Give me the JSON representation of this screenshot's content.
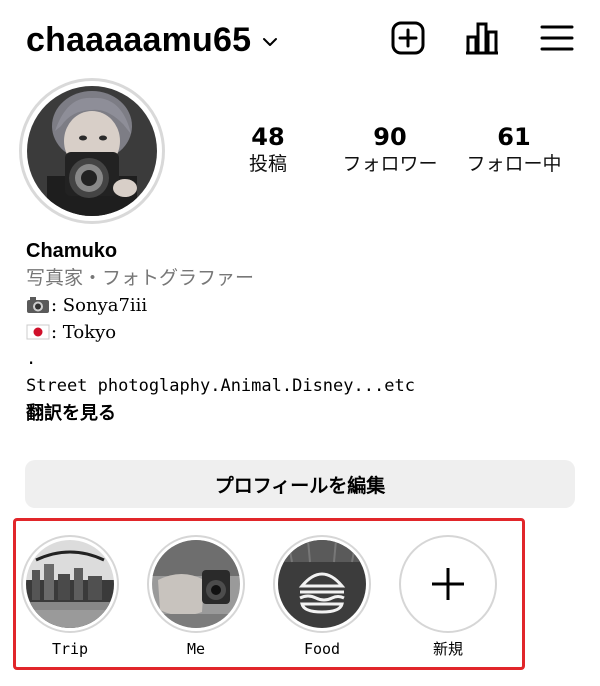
{
  "header": {
    "username": "chaaaaamu65"
  },
  "stats": [
    {
      "count": "48",
      "label": "投稿"
    },
    {
      "count": "90",
      "label": "フォロワー"
    },
    {
      "count": "61",
      "label": "フォロー中"
    }
  ],
  "bio": {
    "name": "Chamuko",
    "category": "写真家・フォトグラファー",
    "camera": ": Sonya7iii",
    "location": ": Tokyo",
    "dot": ".",
    "description": "Street photoglaphy.Animal.Disney...etc",
    "translate": "翻訳を見る"
  },
  "edit_profile_label": "プロフィールを編集",
  "highlights": [
    {
      "label": "Trip"
    },
    {
      "label": "Me"
    },
    {
      "label": "Food"
    },
    {
      "label": "新規"
    }
  ],
  "colors": {
    "highlight_box": "#e1262a",
    "edit_button_bg": "#efefef",
    "category_gray": "#777777"
  }
}
